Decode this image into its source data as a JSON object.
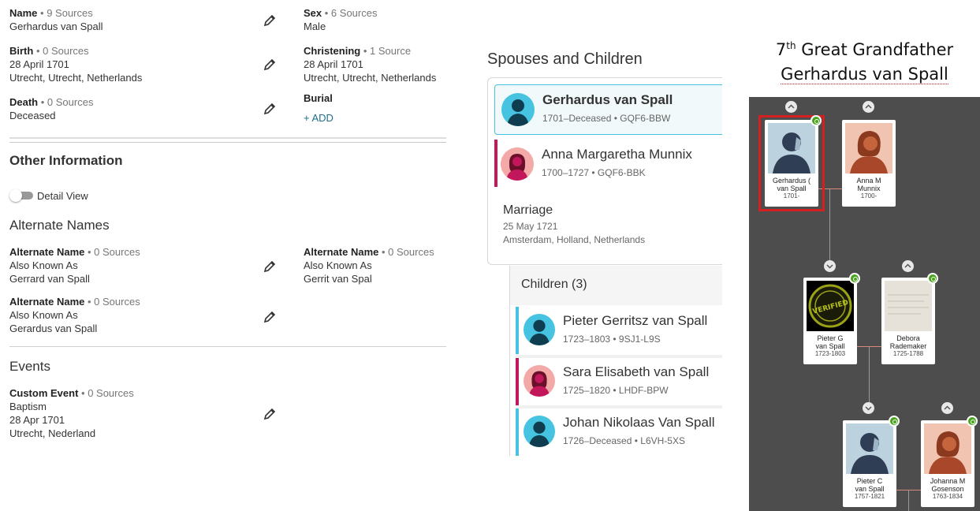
{
  "facts": {
    "name": {
      "label": "Name",
      "sources": "• 9 Sources",
      "value": "Gerhardus van Spall"
    },
    "sex": {
      "label": "Sex",
      "sources": "• 6 Sources",
      "value": "Male"
    },
    "birth": {
      "label": "Birth",
      "sources": "• 0 Sources",
      "date": "28 April 1701",
      "place": "Utrecht, Utrecht, Netherlands"
    },
    "christening": {
      "label": "Christening",
      "sources": "• 1 Source",
      "date": "28 April 1701",
      "place": "Utrecht, Utrecht, Netherlands"
    },
    "death": {
      "label": "Death",
      "sources": "• 0 Sources",
      "value": "Deceased"
    },
    "burial": {
      "label": "Burial",
      "add": "+  ADD"
    }
  },
  "other": {
    "title": "Other Information",
    "detail_view": "Detail View",
    "alt_names_title": "Alternate Names",
    "alt_names": [
      {
        "label": "Alternate Name",
        "sources": "• 0 Sources",
        "type": "Also Known As",
        "value": "Gerrard van Spall"
      },
      {
        "label": "Alternate Name",
        "sources": "• 0 Sources",
        "type": "Also Known As",
        "value": "Gerrit van Spal"
      },
      {
        "label": "Alternate Name",
        "sources": "• 0 Sources",
        "type": "Also Known As",
        "value": "Gerardus van Spall"
      }
    ],
    "events_title": "Events",
    "event": {
      "label": "Custom Event",
      "sources": "• 0 Sources",
      "type": "Baptism",
      "date": "28 Apr 1701",
      "place": "Utrecht, Nederland"
    }
  },
  "spouses": {
    "title": "Spouses and Children",
    "husband": {
      "name": "Gerhardus van Spall",
      "meta": "1701–Deceased •  GQF6-BBW"
    },
    "wife": {
      "name": "Anna Margaretha Munnix",
      "meta": "1700–1727 •  GQF6-BBK"
    },
    "marriage": {
      "label": "Marriage",
      "date": "25 May 1721",
      "place": "Amsterdam, Holland, Netherlands"
    },
    "children_title": "Children (3)",
    "children": [
      {
        "name": "Pieter Gerritsz van Spall",
        "meta": "1723–1803 •  9SJ1-L9S",
        "sex": "male"
      },
      {
        "name": "Sara Elisabeth van Spall",
        "meta": "1725–1820 •  LHDF-BPW",
        "sex": "female"
      },
      {
        "name": "Johan Nikolaas Van Spall",
        "meta": "1726–Deceased •  L6VH-5XS",
        "sex": "male"
      }
    ]
  },
  "tree": {
    "title_line1_pre": "7",
    "title_line1_sup": "th",
    "title_line1_post": " Great Grandfather",
    "title_line2": "Gerhardus van Spall",
    "cards": [
      {
        "n1": "Gerhardus (",
        "n2": "van Spall",
        "n3": "1701-"
      },
      {
        "n1": "Anna M",
        "n2": "Munnix",
        "n3": "1700-"
      },
      {
        "n1": "Pieter G",
        "n2": "van Spall",
        "n3": "1723-1803"
      },
      {
        "n1": "Debora",
        "n2": "Rademaker",
        "n3": "1725-1788"
      },
      {
        "n1": "Pieter C",
        "n2": "van Spall",
        "n3": "1757-1821"
      },
      {
        "n1": "Johanna M",
        "n2": "Gosenson",
        "n3": "1763-1834"
      }
    ],
    "verified_text": "VERIFIED"
  },
  "colors": {
    "male": "#45c3e0",
    "female": "#c2185b",
    "link": "#1f6e8c",
    "highlight": "#d42020",
    "tree_bg": "#4d4d4d",
    "leaf": "#4aa51d"
  }
}
